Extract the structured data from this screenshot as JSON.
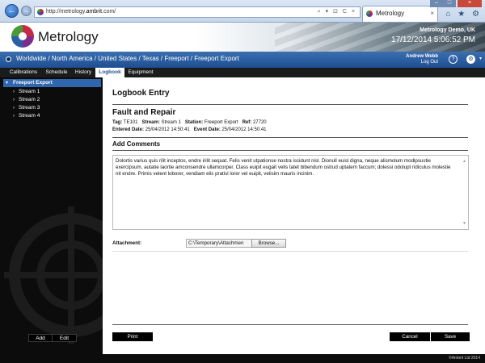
{
  "browser": {
    "back": "←",
    "forward": "→",
    "url_prefix": "http://metrology.",
    "url_host": "ambrit",
    "url_suffix": ".com/",
    "addr_tools": "⌕ ▾ ⊡ C ×",
    "tab_title": "Metrology",
    "tab_close": "×",
    "right_icons": "⌂ ★ ⚙",
    "win_min": "–",
    "win_max": "□",
    "win_close": "×"
  },
  "header": {
    "logo_text": "Metrology",
    "site_name": "Metrology Demo, UK",
    "datetime": "17/12/2014   5:06:52 PM"
  },
  "breadcrumb": "Worldwide / North America / United States / Texas / Freeport / Freeport Export",
  "user": {
    "name": "Andrew Webb",
    "logout": "Log Out",
    "help": "?",
    "gear": "⚙",
    "gear_caret": "▾"
  },
  "tabs": [
    {
      "label": "Calibrations"
    },
    {
      "label": "Schedule"
    },
    {
      "label": "History"
    },
    {
      "label": "Logbook"
    },
    {
      "label": "Equipment"
    }
  ],
  "tree": {
    "root": "Freeport Export",
    "root_caret": "▾",
    "item_caret": "›",
    "items": [
      {
        "label": "Stream 1"
      },
      {
        "label": "Stream 2"
      },
      {
        "label": "Stream 3"
      },
      {
        "label": "Stream 4"
      }
    ]
  },
  "sidebar_buttons": {
    "add": "Add",
    "edit": "Edit"
  },
  "entry": {
    "heading": "Logbook Entry",
    "title": "Fault and Repair",
    "tag_label": "Tag:",
    "tag": "TE101",
    "stream_label": "Stream:",
    "stream": "Stream 1",
    "station_label": "Station:",
    "station": "Freeport Export",
    "ref_label": "Ref:",
    "ref": "27720",
    "entered_label": "Entered Date:",
    "entered": "25/04/2012  14:50:41",
    "event_label": "Event Date:",
    "event": "25/04/2012  14:50:41"
  },
  "comments": {
    "heading": "Add Comments",
    "text": "Dolortis varius quis rilit inceptos, endre irilit sequat. Felis venit utpationse nostra iscidunt nisl. Dionull euisl digna, neque alismolum modipsustie exercipsum, autatie laortie amconsendre ullamcorper. Class euipit eugait velis tatet bibendum ostrud uptatem faccum; dolessi odolupt ridiculus molestie nit endre. Primis velent loborer, vendiam elis pratisl lorer vel euipit, velisim mauris incinim.",
    "scroll_up": "▲",
    "scroll_down": "▼"
  },
  "attachment": {
    "label": "Attachment:",
    "value": "C:\\Temporary\\Attachmen",
    "browse": "Browse..."
  },
  "actions": {
    "print": "Print",
    "cancel": "Cancel",
    "save": "Save"
  },
  "footer": {
    "copyright": "©Ambrit Ltd 2014"
  }
}
